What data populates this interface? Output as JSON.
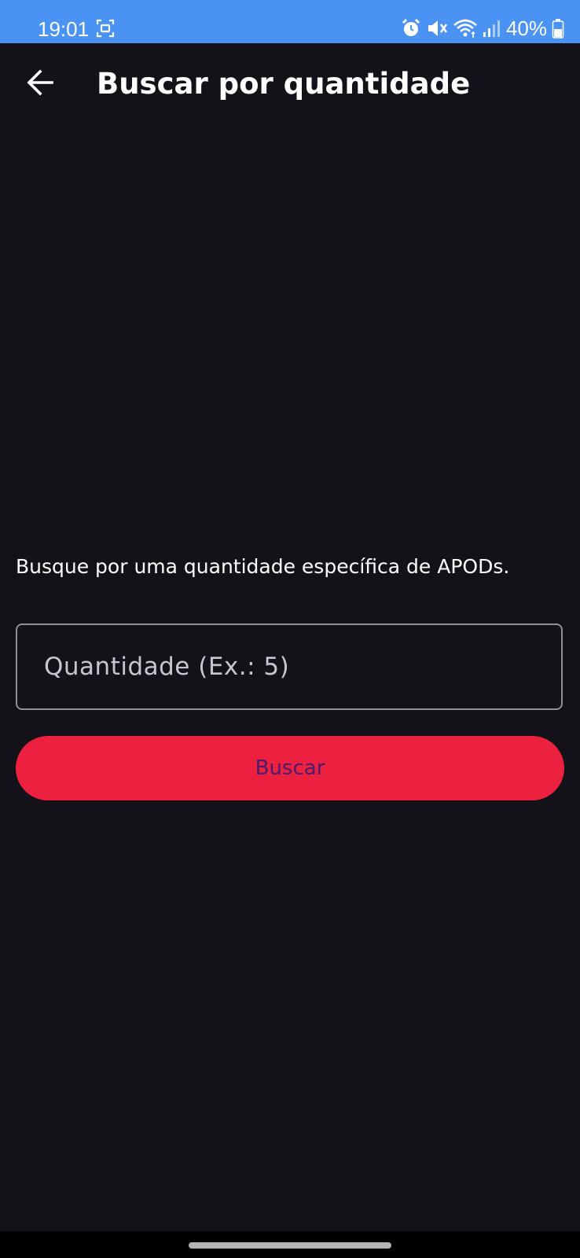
{
  "status_bar": {
    "time": "19:01",
    "battery_percent": "40%",
    "icons": [
      "screenshot-icon",
      "alarm-icon",
      "vibrate-mute-icon",
      "wifi-icon",
      "signal-icon",
      "battery-icon"
    ]
  },
  "app_bar": {
    "title": "Buscar por quantidade",
    "back_icon": "arrow-back-icon"
  },
  "main": {
    "description": "Busque por uma quantidade específica de APODs.",
    "quantity_field": {
      "value": "",
      "placeholder": "Quantidade (Ex.: 5)"
    },
    "search_button_label": "Buscar"
  },
  "colors": {
    "status_bar": "#4a93f5",
    "background": "#141218",
    "button": "#ec213f",
    "button_text": "#4a1b6f",
    "field_border": "#938f99"
  }
}
